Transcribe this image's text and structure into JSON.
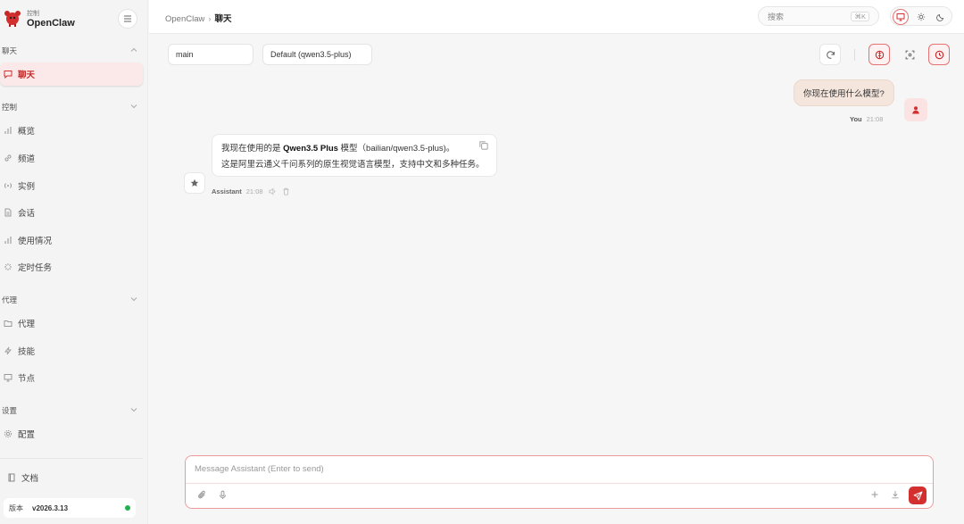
{
  "brand": {
    "subtitle": "控制",
    "title": "OpenClaw"
  },
  "sidebar": {
    "sections": [
      {
        "title": "聊天",
        "items": [
          {
            "label": "聊天",
            "icon": "message-icon",
            "active": true
          }
        ]
      },
      {
        "title": "控制",
        "items": [
          {
            "label": "概览",
            "icon": "bar-chart-icon"
          },
          {
            "label": "频道",
            "icon": "link-icon"
          },
          {
            "label": "实例",
            "icon": "broadcast-icon"
          },
          {
            "label": "会话",
            "icon": "document-icon"
          },
          {
            "label": "使用情况",
            "icon": "bar-chart-icon"
          },
          {
            "label": "定时任务",
            "icon": "loader-icon"
          }
        ]
      },
      {
        "title": "代理",
        "items": [
          {
            "label": "代理",
            "icon": "folder-icon"
          },
          {
            "label": "技能",
            "icon": "zap-icon"
          },
          {
            "label": "节点",
            "icon": "monitor-icon"
          }
        ]
      },
      {
        "title": "设置",
        "items": [
          {
            "label": "配置",
            "icon": "gear-icon"
          }
        ]
      }
    ],
    "docs_label": "文档",
    "version_label": "版本",
    "version_value": "v2026.3.13"
  },
  "topbar": {
    "breadcrumb_root": "OpenClaw",
    "breadcrumb_sep": "›",
    "breadcrumb_current": "聊天",
    "search_placeholder": "搜索",
    "search_shortcut": "⌘K"
  },
  "chat": {
    "session_value": "main",
    "model_value": "Default (qwen3.5-plus)",
    "user_message": "你现在使用什么模型?",
    "user_name": "You",
    "user_time": "21:08",
    "assistant_line1_prefix": "我现在使用的是 ",
    "assistant_line1_bold": "Qwen3.5 Plus",
    "assistant_line1_suffix": " 模型（bailian/qwen3.5-plus)。",
    "assistant_line2": "这是阿里云通义千问系列的原生视觉语言模型，支持中文和多种任务。",
    "assistant_name": "Assistant",
    "assistant_time": "21:08"
  },
  "composer": {
    "placeholder": "Message Assistant (Enter to send)"
  },
  "colors": {
    "accent": "#d32f2f",
    "active_bg": "#fbe9e9",
    "user_bubble": "#f5e6dd",
    "status_online": "#22b14c"
  }
}
